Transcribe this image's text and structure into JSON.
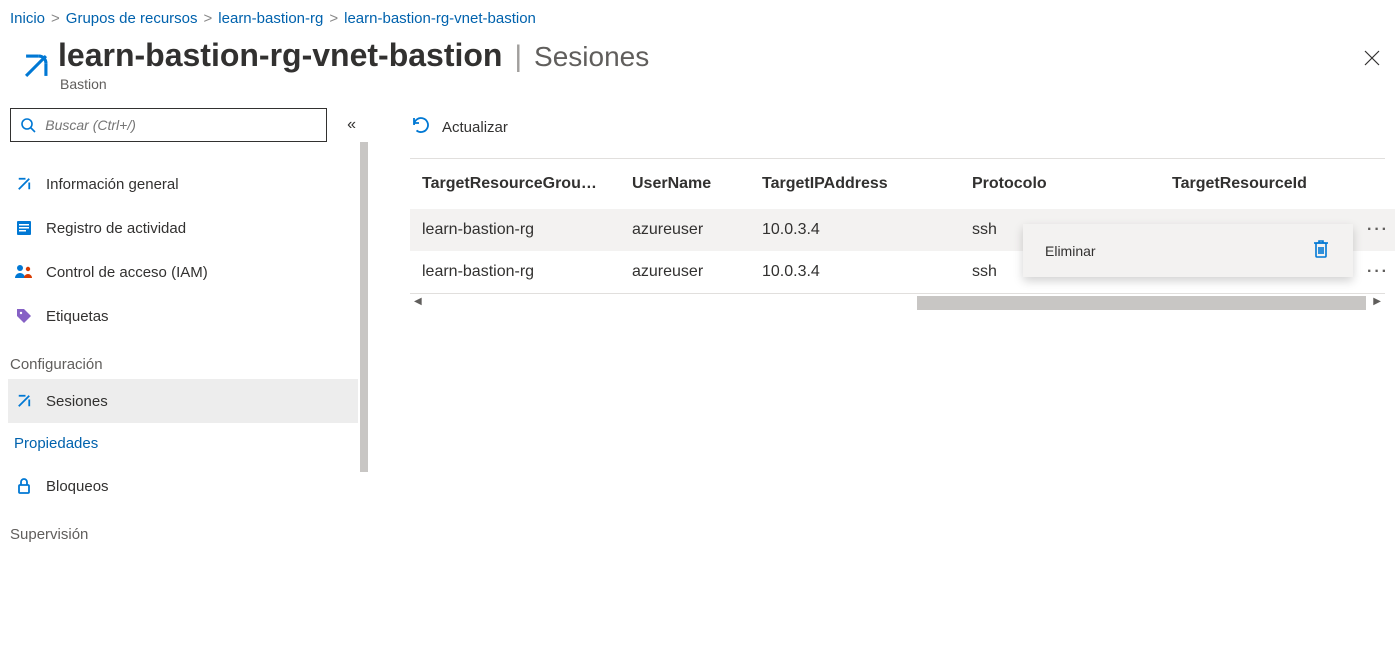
{
  "breadcrumb": {
    "home": "Inicio",
    "item1": "Grupos de recursos",
    "item2": "learn-bastion-rg",
    "item3": "learn-bastion-rg-vnet-bastion"
  },
  "header": {
    "title": "learn-bastion-rg-vnet-bastion",
    "page": "Sesiones",
    "type": "Bastion"
  },
  "search": {
    "placeholder": "Buscar (Ctrl+/)"
  },
  "nav": {
    "items": [
      {
        "label": "Información general"
      },
      {
        "label": "Registro de actividad"
      },
      {
        "label": "Control de acceso (IAM)"
      },
      {
        "label": "Etiquetas"
      }
    ],
    "config_section": "Configuración",
    "config_items": [
      {
        "label": "Sesiones",
        "selected": true
      },
      {
        "label": "Propiedades",
        "link": true
      },
      {
        "label": "Bloqueos"
      }
    ],
    "supervision_section": "Supervisión"
  },
  "toolbar": {
    "refresh": "Actualizar"
  },
  "table": {
    "headers": {
      "rg": "TargetResourceGrou…",
      "user": "UserName",
      "ip": "TargetIPAddress",
      "proto": "Protocolo",
      "rid": "TargetResourceId"
    },
    "rows": [
      {
        "rg": "learn-bastion-rg",
        "user": "azureuser",
        "ip": "10.0.3.4",
        "proto": "ssh"
      },
      {
        "rg": "learn-bastion-rg",
        "user": "azureuser",
        "ip": "10.0.3.4",
        "proto": "ssh"
      }
    ]
  },
  "context_menu": {
    "delete": "Eliminar"
  }
}
